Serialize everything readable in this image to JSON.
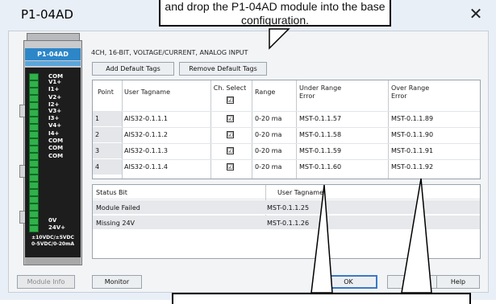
{
  "window": {
    "title": "P1-04AD",
    "close_glyph": "✕"
  },
  "callout_top": {
    "line1": "and drop the P1-04AD module into the base",
    "line2": "configuration."
  },
  "callout_bottom": {
    "text": ""
  },
  "module": {
    "label": "P1-04AD",
    "pins": [
      "COM",
      "V1+",
      "I1+",
      "V2+",
      "I2+",
      "V3+",
      "I3+",
      "V4+",
      "I4+",
      "COM",
      "COM",
      "COM",
      "0V",
      "24V+"
    ],
    "rating_line1": "±10VDC/±5VDC",
    "rating_line2": "0-5VDC/0-20mA"
  },
  "description": "4CH, 16-BIT, VOLTAGE/CURRENT, ANALOG INPUT",
  "buttons": {
    "add_default_tags": "Add Default Tags",
    "remove_default_tags": "Remove Default Tags",
    "module_info": "Module Info",
    "monitor": "Monitor",
    "ok": "OK",
    "cancel": "Canc",
    "help": "Help"
  },
  "channel_table": {
    "headers": {
      "point": "Point",
      "user_tagname": "User Tagname",
      "ch_select": "Ch. Select",
      "range": "Range",
      "under_range_line1": "Under Range",
      "under_range_line2": "Error",
      "over_range_line1": "Over Range",
      "over_range_line2": "Error"
    },
    "header_checkbox_glyph": "☑",
    "rows": [
      {
        "point": "1",
        "tag": "AIS32-0.1.1.1",
        "check": "☑",
        "range": "0-20 ma",
        "under": "MST-0.1.1.57",
        "over": "MST-0.1.1.89"
      },
      {
        "point": "2",
        "tag": "AIS32-0.1.1.2",
        "check": "☑",
        "range": "0-20 ma",
        "under": "MST-0.1.1.58",
        "over": "MST-0.1.1.90"
      },
      {
        "point": "3",
        "tag": "AIS32-0.1.1.3",
        "check": "☑",
        "range": "0-20 ma",
        "under": "MST-0.1.1.59",
        "over": "MST-0.1.1.91"
      },
      {
        "point": "4",
        "tag": "AIS32-0.1.1.4",
        "check": "☑",
        "range": "0-20 ma",
        "under": "MST-0.1.1.60",
        "over": "MST-0.1.1.92"
      }
    ]
  },
  "status_table": {
    "headers": {
      "status_bit": "Status Bit",
      "user_tagname": "User Tagname"
    },
    "rows": [
      {
        "bit": "Module Failed",
        "tag": "MST-0.1.1.25"
      },
      {
        "bit": "Missing 24V",
        "tag": "MST-0.1.1.26"
      }
    ]
  },
  "colors": {
    "module_label_bg": "#2d86c8",
    "terminal_green": "#31b04b",
    "ok_border": "#3a79c7"
  }
}
